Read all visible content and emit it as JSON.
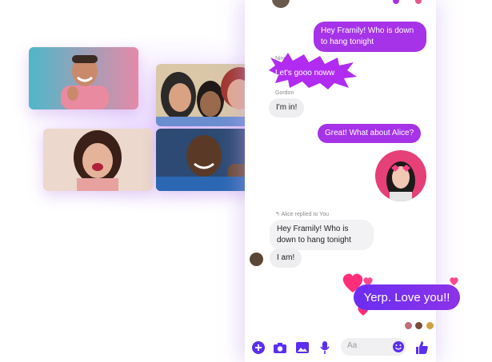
{
  "theme": {
    "accent": "#a633e8",
    "accent_blue": "#5b2ef0",
    "bubble_gray": "#eeeef0"
  },
  "video_tiles": [
    {
      "icon": "person-laughing"
    },
    {
      "icon": "group-selfie"
    },
    {
      "icon": "woman-laughing"
    },
    {
      "icon": "man-smiling"
    }
  ],
  "chat": {
    "messages": [
      {
        "id": "m1",
        "from": "me",
        "text": "Hey Framily! Who is down to hang tonight"
      },
      {
        "id": "m2",
        "from": "Ning",
        "sender_label": "Ning",
        "text": "Let's gooo noww"
      },
      {
        "id": "m3",
        "from": "Gordon",
        "sender_label": "Gordon",
        "text": "I'm in!"
      },
      {
        "id": "m4",
        "from": "me",
        "text": "Great! What about Alice?"
      },
      {
        "id": "m5",
        "from": "Alice",
        "reply_label": "Alice replied to You",
        "text": "Hey Framily! Who is down to hang tonight"
      },
      {
        "id": "m6",
        "from": "Alice",
        "text": "I am!"
      },
      {
        "id": "m7",
        "from": "me",
        "text": "Yerp. Love you!!"
      }
    ]
  },
  "composer": {
    "placeholder": "Aa"
  },
  "toolbar": {
    "icons": [
      "plus-icon",
      "camera-icon",
      "photo-icon",
      "mic-icon",
      "emoji-icon",
      "thumbs-up-icon"
    ]
  }
}
